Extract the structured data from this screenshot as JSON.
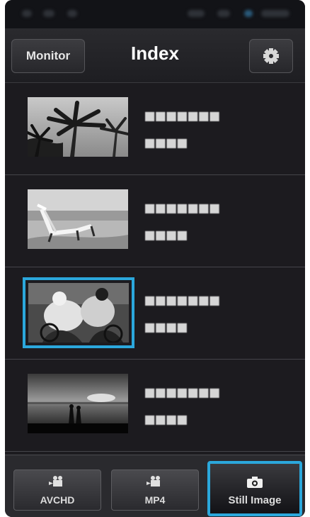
{
  "header": {
    "monitor_label": "Monitor",
    "title": "Index",
    "settings_icon": "gear-icon"
  },
  "items": [
    {
      "thumbnail": "palm-trees",
      "title_masked": "■■■■■■■",
      "date_masked": "■■■■",
      "selected": false
    },
    {
      "thumbnail": "beach-chair",
      "title_masked": "■■■■■■■",
      "date_masked": "■■■■",
      "selected": false
    },
    {
      "thumbnail": "cyclists",
      "title_masked": "■■■■■■■",
      "date_masked": "■■■■",
      "selected": true
    },
    {
      "thumbnail": "sunset-couple",
      "title_masked": "■■■■■■■",
      "date_masked": "■■■■",
      "selected": false
    }
  ],
  "tabs": [
    {
      "label": "AVCHD",
      "icon": "video-camera-icon",
      "active": false
    },
    {
      "label": "MP4",
      "icon": "video-camera-icon",
      "active": false
    },
    {
      "label": "Still Image",
      "icon": "camera-icon",
      "active": true
    }
  ],
  "colors": {
    "accent": "#2ba8dc",
    "background": "#1c1b1f",
    "header": "#2a2a2e"
  }
}
